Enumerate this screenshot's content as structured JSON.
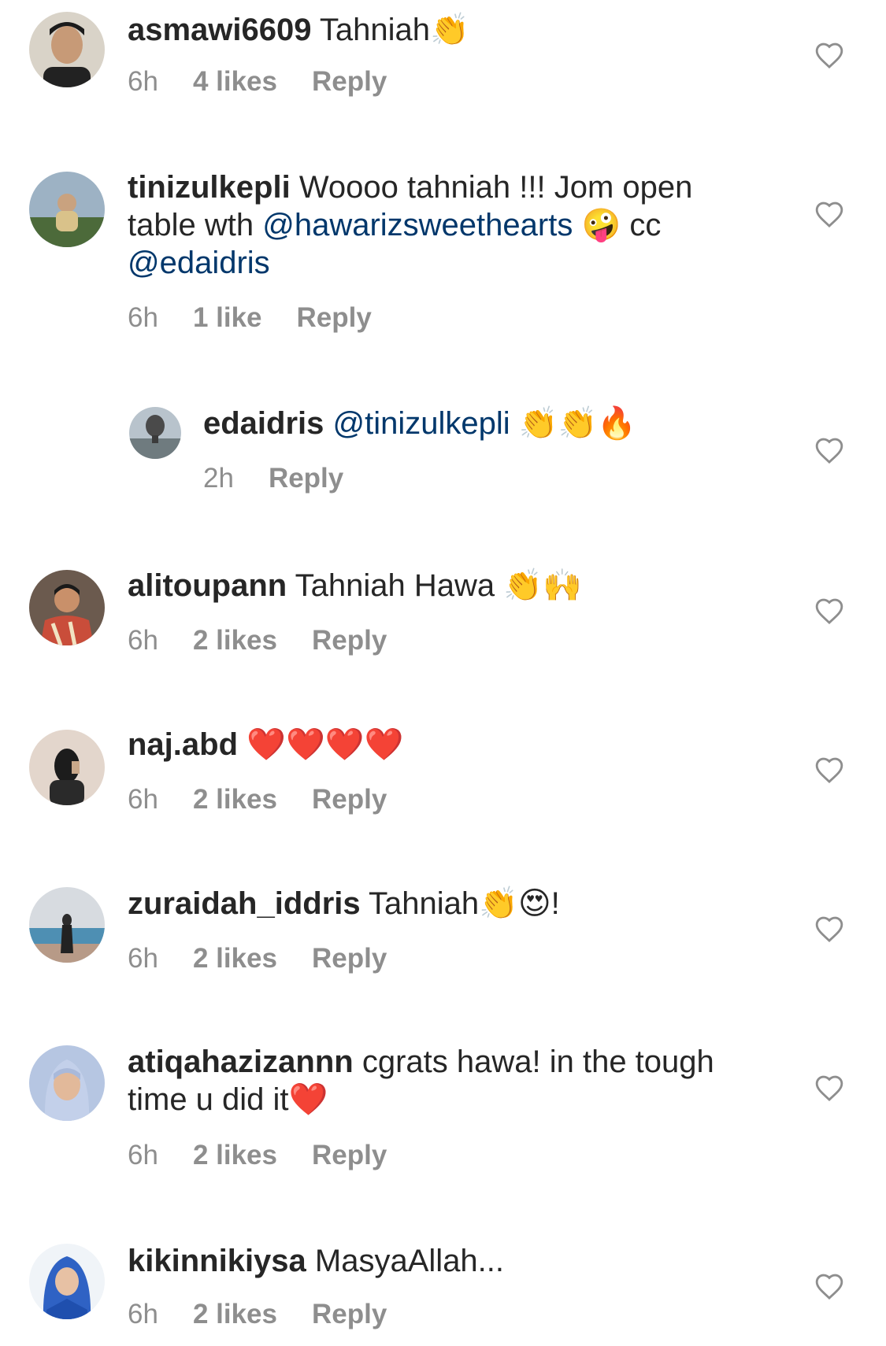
{
  "comments": [
    {
      "user": "asmawi6609",
      "text": "Tahniah👏",
      "time": "6h",
      "likes": "4 likes",
      "reply": "Reply",
      "avatar_bg": "#6d5f51"
    },
    {
      "user": "tinizulkepli",
      "text1": "Woooo tahniah !!! Jom open table wth ",
      "mention1": "@hawarizsweethearts",
      "text2": " 🤪 cc ",
      "mention2": "@edaidris",
      "time": "6h",
      "likes": "1 like",
      "reply": "Reply",
      "avatar_bg": "#8aa0b2"
    },
    {
      "user": "edaidris",
      "mention": "@tinizulkepli",
      "text": " 👏👏🔥",
      "time": "2h",
      "reply": "Reply",
      "avatar_bg": "#9aa7b0"
    },
    {
      "user": "alitoupann",
      "text": "Tahniah Hawa 👏🙌",
      "time": "6h",
      "likes": "2 likes",
      "reply": "Reply",
      "avatar_bg": "#b44a3a"
    },
    {
      "user": "naj.abd",
      "text": "❤️❤️❤️❤️",
      "time": "6h",
      "likes": "2 likes",
      "reply": "Reply",
      "avatar_bg": "#d8c9bd"
    },
    {
      "user": "zuraidah_iddris",
      "text": "Tahniah👏😍!",
      "time": "6h",
      "likes": "2 likes",
      "reply": "Reply",
      "avatar_bg": "#8fb3c6"
    },
    {
      "user": "atiqahazizannn",
      "text": "cgrats hawa! in the tough time u did it❤️",
      "time": "6h",
      "likes": "2 likes",
      "reply": "Reply",
      "avatar_bg": "#b9c8e0"
    },
    {
      "user": "kikinnikiysa",
      "text": "MasyaAllah...",
      "time": "6h",
      "likes": "2 likes",
      "reply": "Reply",
      "avatar_bg": "#e6eef6"
    }
  ],
  "colors": {
    "text": "#262626",
    "meta": "#8e8e8e",
    "mention": "#00376b",
    "heart": "#8e8e8e"
  },
  "icons": {
    "like": "heart-outline-icon"
  }
}
